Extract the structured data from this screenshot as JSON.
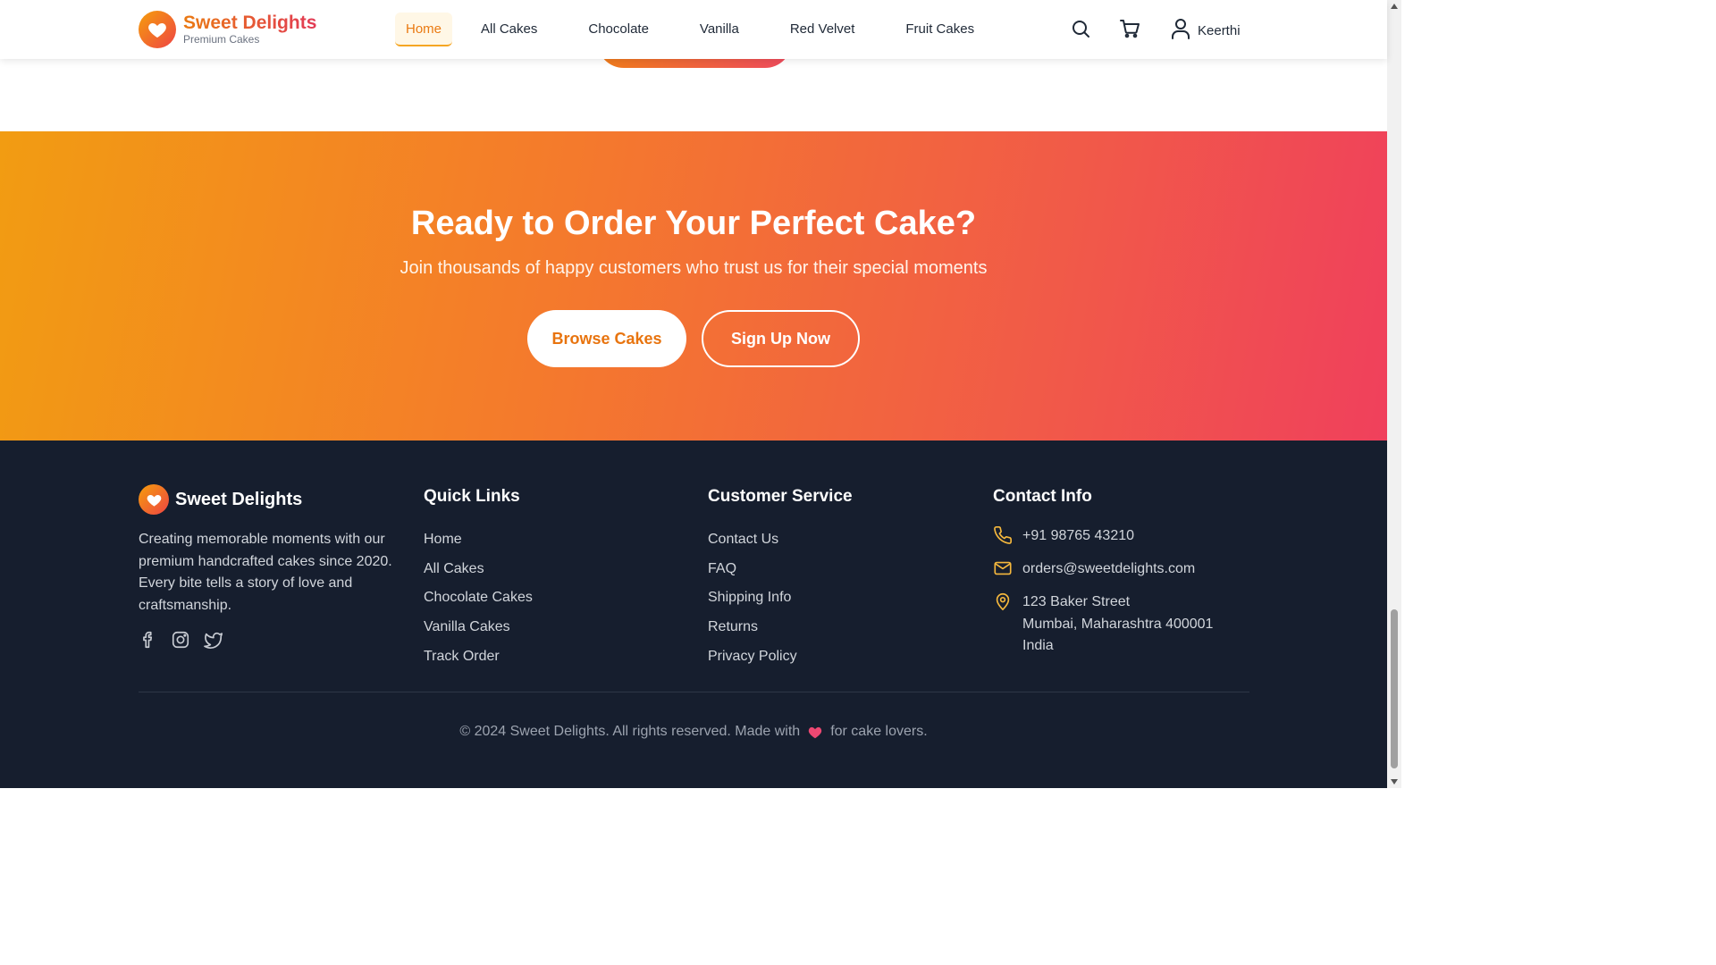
{
  "header": {
    "brand": "Sweet Delights",
    "brand_sub": "Premium Cakes",
    "nav": [
      "Home",
      "All Cakes",
      "Chocolate",
      "Vanilla",
      "Red Velvet",
      "Fruit Cakes"
    ],
    "active_nav": "Home",
    "user_name": "Keerthi",
    "icons": [
      "search-icon",
      "cart-icon",
      "user-icon"
    ]
  },
  "cta": {
    "title": "Ready to Order Your Perfect Cake?",
    "subtitle": "Join thousands of happy customers who trust us for their special moments",
    "browse_label": "Browse Cakes",
    "signup_label": "Sign Up Now"
  },
  "footer": {
    "brand": "Sweet Delights",
    "description": "Creating memorable moments with our premium handcrafted cakes since 2020. Every bite tells a story of love and craftsmanship.",
    "social": [
      "facebook-icon",
      "instagram-icon",
      "twitter-icon"
    ],
    "quick_links": {
      "title": "Quick Links",
      "items": [
        "Home",
        "All Cakes",
        "Chocolate Cakes",
        "Vanilla Cakes",
        "Track Order"
      ]
    },
    "customer_service": {
      "title": "Customer Service",
      "items": [
        "Contact Us",
        "FAQ",
        "Shipping Info",
        "Returns",
        "Privacy Policy"
      ]
    },
    "contact": {
      "title": "Contact Info",
      "phone": "+91 98765 43210",
      "email": "orders@sweetdelights.com",
      "address_line1": "123 Baker Street",
      "address_line2": "Mumbai, Maharashtra 400001",
      "address_line3": "India"
    },
    "copyright_pre": "© 2024 Sweet Delights. All rights reserved. Made with",
    "copyright_post": "for cake lovers."
  },
  "colors": {
    "accent_orange": "#f29c12",
    "accent_pink": "#f0405c",
    "footer_bg": "#161e2e",
    "contact_icon": "#f5b83d"
  }
}
